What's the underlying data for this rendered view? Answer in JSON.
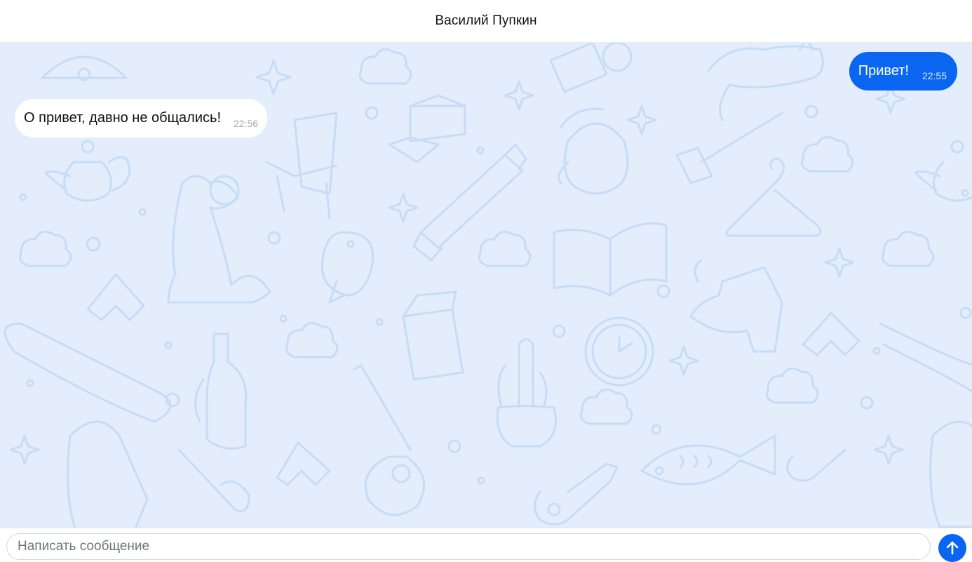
{
  "header": {
    "title": "Василий Пупкин"
  },
  "messages": [
    {
      "direction": "outgoing",
      "text": "Привет!",
      "time": "22:55"
    },
    {
      "direction": "incoming",
      "text": "О привет, давно не общались!",
      "time": "22:56"
    }
  ],
  "composer": {
    "placeholder": "Написать сообщение",
    "value": "",
    "send_icon": "arrow-up-icon"
  },
  "colors": {
    "accent": "#0a66f0",
    "chat_background": "#e3edfb",
    "wallpaper_doodle": "#c7dcf7",
    "outgoing_bubble": "#0a66f0",
    "incoming_bubble": "#ffffff"
  }
}
